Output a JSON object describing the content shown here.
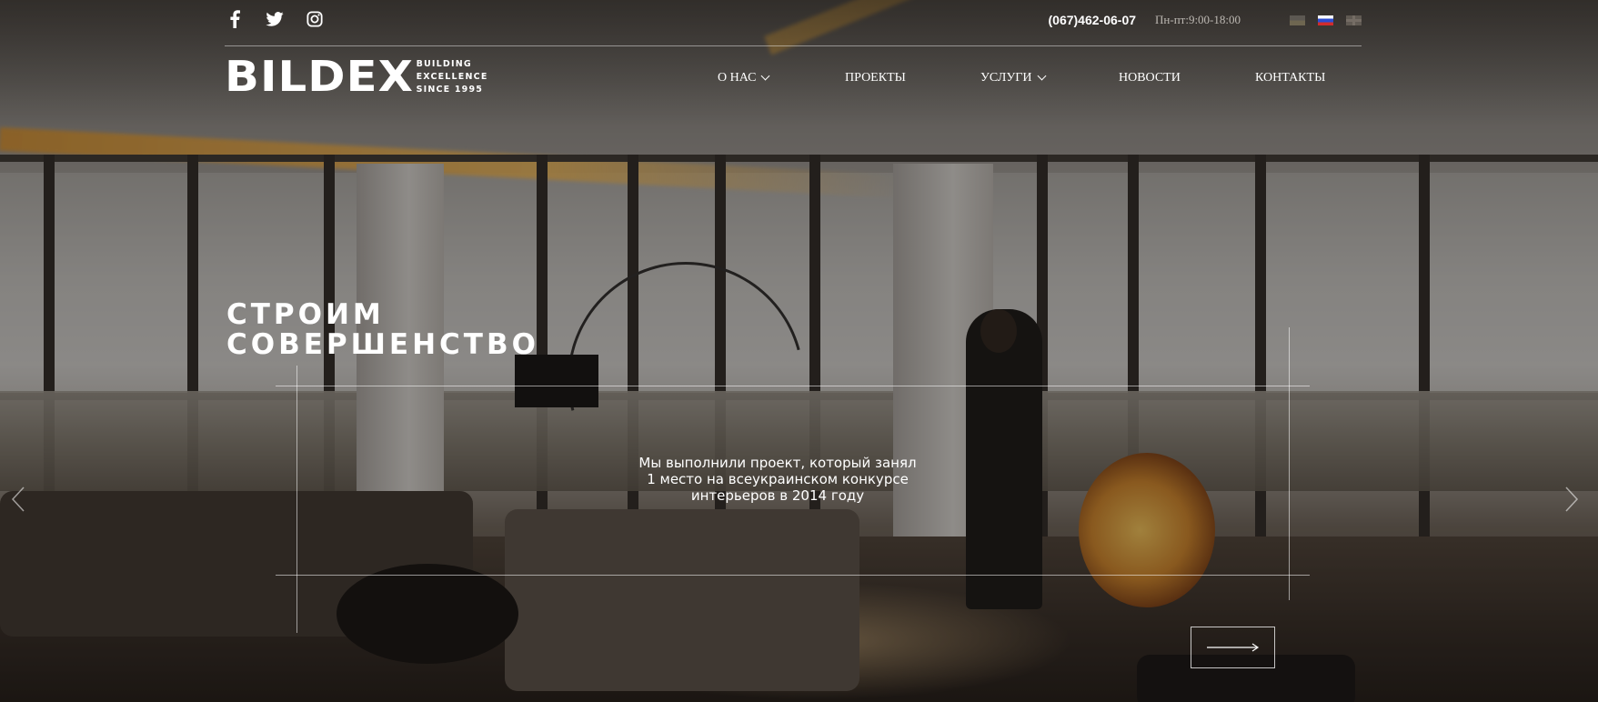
{
  "header": {
    "social": [
      {
        "name": "facebook",
        "icon": "facebook-icon"
      },
      {
        "name": "twitter",
        "icon": "twitter-icon"
      },
      {
        "name": "instagram",
        "icon": "instagram-icon"
      }
    ],
    "phone": "(067)462-06-07",
    "hours": "Пн-пт:9:00-18:00",
    "languages": [
      {
        "code": "ua",
        "icon": "flag-ua-icon",
        "active": false
      },
      {
        "code": "ru",
        "icon": "flag-ru-icon",
        "active": true
      },
      {
        "code": "en",
        "icon": "flag-en-icon",
        "active": false
      }
    ]
  },
  "logo": {
    "mark": "BILDEX",
    "tagline": [
      "BUILDING",
      "EXCELLENCE",
      "SINCE 1995"
    ]
  },
  "nav": {
    "items": [
      {
        "label": "О НАС",
        "dropdown": true
      },
      {
        "label": "ПРОЕКТЫ",
        "dropdown": false
      },
      {
        "label": "УСЛУГИ",
        "dropdown": true
      },
      {
        "label": "НОВОСТИ",
        "dropdown": false
      },
      {
        "label": "КОНТАКТЫ",
        "dropdown": false
      }
    ]
  },
  "hero": {
    "title_line1": "СТРОИМ",
    "title_line2": "СОВЕРШЕНСТВО",
    "text": "Мы выполнили проект, который занял 1 место на всеукраинском конкурсе интерьеров в 2014 году",
    "next_icon": "long-arrow-right-icon"
  },
  "colors": {
    "text": "#ffffff",
    "muted": "#bdb9b3",
    "accent_glow": "#f0ba5a"
  }
}
